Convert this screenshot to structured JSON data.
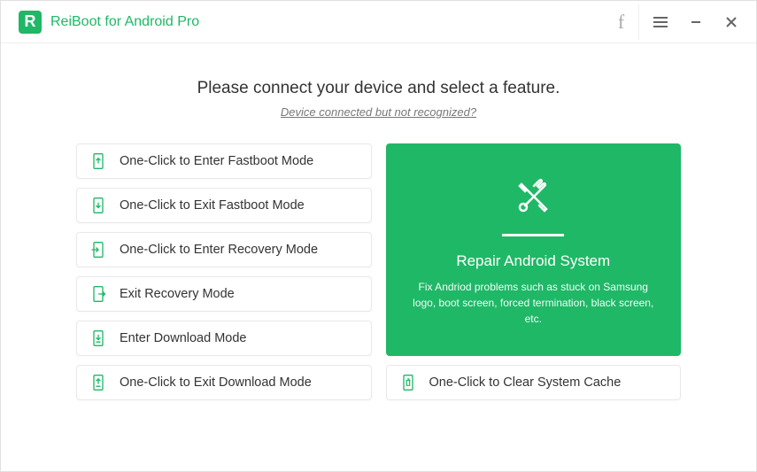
{
  "app": {
    "title": "ReiBoot for Android Pro",
    "logo_letter": "R"
  },
  "titlebar": {
    "facebook": "f",
    "menu": "☰",
    "minimize": "—",
    "close": "✕"
  },
  "main": {
    "heading": "Please connect your device and select a feature.",
    "sublink": "Device connected but not recognized?"
  },
  "options": {
    "enter_fastboot": "One-Click to Enter Fastboot Mode",
    "exit_fastboot": "One-Click to Exit Fastboot Mode",
    "enter_recovery": "One-Click to Enter Recovery Mode",
    "exit_recovery": "Exit Recovery Mode",
    "enter_download": "Enter Download Mode",
    "exit_download": "One-Click to Exit Download Mode",
    "clear_cache": "One-Click to Clear System Cache"
  },
  "repair": {
    "title": "Repair Android System",
    "desc": "Fix Andriod problems such as stuck on Samsung logo, boot screen, forced termination, black screen, etc."
  },
  "colors": {
    "brand": "#1fb866"
  }
}
